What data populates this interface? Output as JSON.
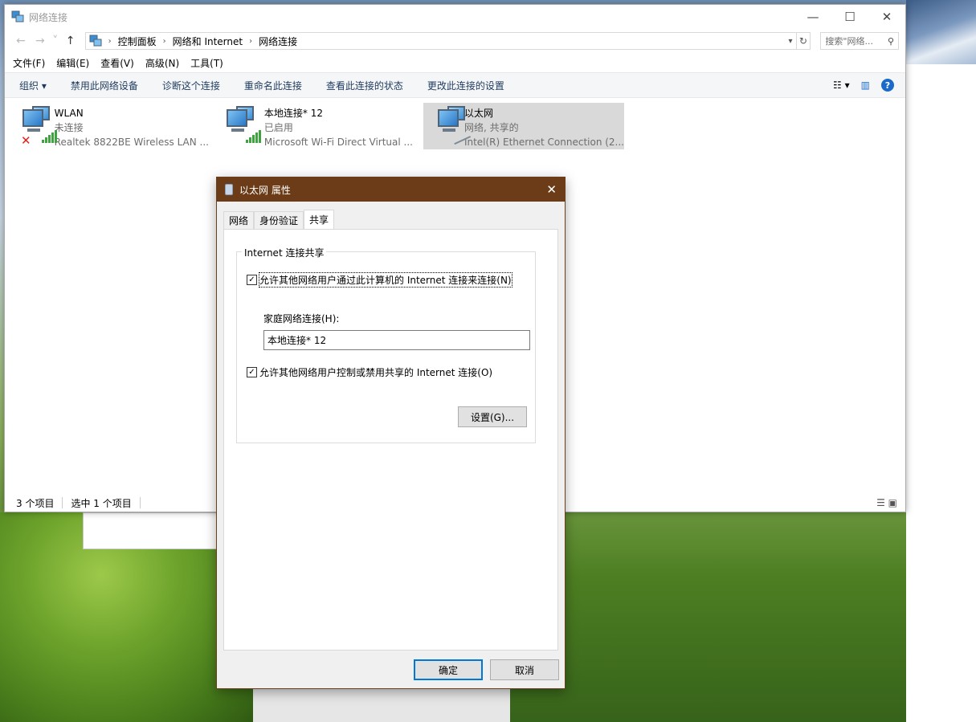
{
  "explorer": {
    "title": "网络连接",
    "window_controls": {
      "minimize": "—",
      "maximize": "☐",
      "close": "✕"
    },
    "nav": {
      "back": "←",
      "forward": "→",
      "recent": "˅",
      "up": "↑"
    },
    "breadcrumb": [
      "控制面板",
      "网络和 Internet",
      "网络连接"
    ],
    "search_placeholder": "搜索\"网络...",
    "menu": [
      "文件(F)",
      "编辑(E)",
      "查看(V)",
      "高级(N)",
      "工具(T)"
    ],
    "commands": [
      "组织 ▾",
      "禁用此网络设备",
      "诊断这个连接",
      "重命名此连接",
      "查看此连接的状态",
      "更改此连接的设置"
    ],
    "connections": [
      {
        "name": "WLAN",
        "status": "未连接",
        "device": "Realtek 8822BE Wireless LAN ..."
      },
      {
        "name": "本地连接* 12",
        "status": "已启用",
        "device": "Microsoft Wi-Fi Direct Virtual ..."
      },
      {
        "name": "以太网",
        "status": "网络, 共享的",
        "device": "Intel(R) Ethernet Connection (2..."
      }
    ],
    "status": {
      "count": "3 个项目",
      "selected": "选中 1 个项目"
    }
  },
  "dialog": {
    "title": "以太网 属性",
    "tabs": [
      "网络",
      "身份验证",
      "共享"
    ],
    "group_label": "Internet 连接共享",
    "allow_share": {
      "label": "允许其他网络用户通过此计算机的 Internet 连接来连接(N)",
      "checked": true
    },
    "home_label": "家庭网络连接(H):",
    "home_value": "本地连接* 12",
    "allow_control": {
      "label": "允许其他网络用户控制或禁用共享的 Internet 连接(O)",
      "checked": true
    },
    "settings_button": "设置(G)...",
    "ok_button": "确定",
    "cancel_button": "取消"
  }
}
